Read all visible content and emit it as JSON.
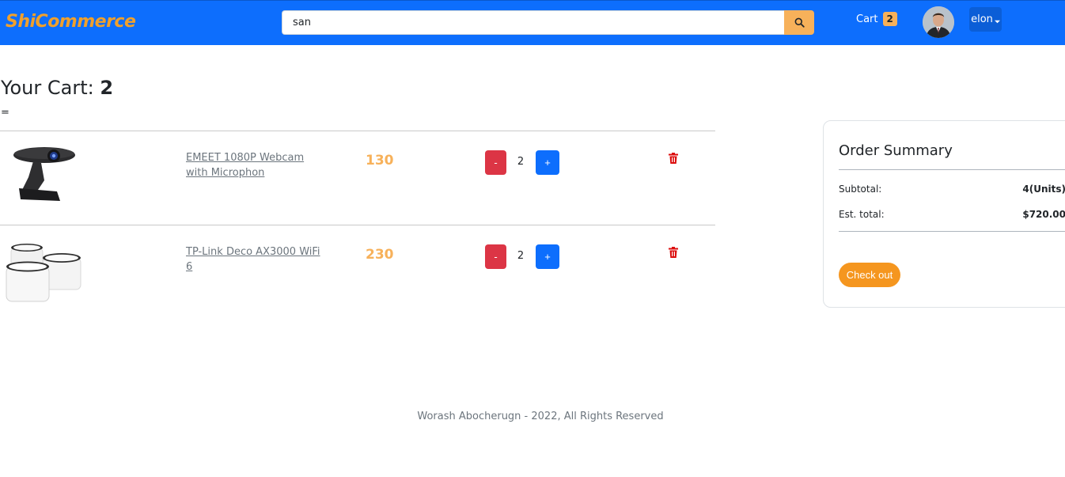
{
  "navbar": {
    "brand": "ShiCommerce",
    "search": {
      "value": "san",
      "placeholder": ""
    },
    "cart_label": "Cart",
    "cart_count": "2",
    "user_name": "elon"
  },
  "cart": {
    "title_prefix": "Your Cart: ",
    "count": "2",
    "marker": "=",
    "items": [
      {
        "name": "EMEET 1080P Webcam with Microphon",
        "price": "130",
        "qty": "2",
        "minus": "-",
        "plus": "+"
      },
      {
        "name": "TP-Link Deco AX3000 WiFi 6",
        "price": "230",
        "qty": "2",
        "minus": "-",
        "plus": "+"
      }
    ]
  },
  "summary": {
    "title": "Order Summary",
    "subtotal_label": "Subtotal:",
    "subtotal_value": "4(Units)",
    "total_label": "Est. total:",
    "total_value": "$720.00",
    "checkout_label": "Check out"
  },
  "footer": {
    "text": "Worash Abocherugn - 2022, All Rights Reserved"
  },
  "colors": {
    "primary": "#0d6efd",
    "accent": "#f7b15a",
    "danger": "#dc3545",
    "checkout": "#f5961f"
  }
}
